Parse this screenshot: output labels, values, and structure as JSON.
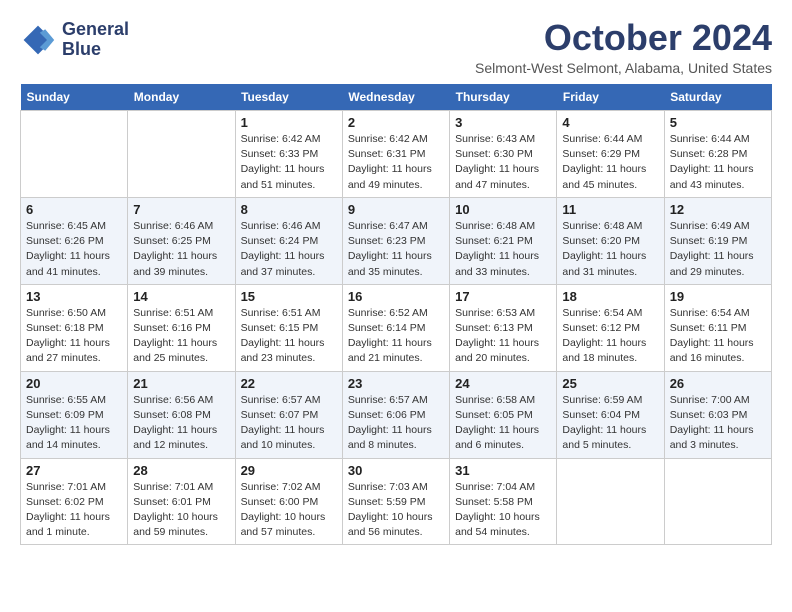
{
  "logo": {
    "line1": "General",
    "line2": "Blue"
  },
  "title": "October 2024",
  "subtitle": "Selmont-West Selmont, Alabama, United States",
  "headers": [
    "Sunday",
    "Monday",
    "Tuesday",
    "Wednesday",
    "Thursday",
    "Friday",
    "Saturday"
  ],
  "weeks": [
    [
      {
        "day": "",
        "info": ""
      },
      {
        "day": "",
        "info": ""
      },
      {
        "day": "1",
        "info": "Sunrise: 6:42 AM\nSunset: 6:33 PM\nDaylight: 11 hours and 51 minutes."
      },
      {
        "day": "2",
        "info": "Sunrise: 6:42 AM\nSunset: 6:31 PM\nDaylight: 11 hours and 49 minutes."
      },
      {
        "day": "3",
        "info": "Sunrise: 6:43 AM\nSunset: 6:30 PM\nDaylight: 11 hours and 47 minutes."
      },
      {
        "day": "4",
        "info": "Sunrise: 6:44 AM\nSunset: 6:29 PM\nDaylight: 11 hours and 45 minutes."
      },
      {
        "day": "5",
        "info": "Sunrise: 6:44 AM\nSunset: 6:28 PM\nDaylight: 11 hours and 43 minutes."
      }
    ],
    [
      {
        "day": "6",
        "info": "Sunrise: 6:45 AM\nSunset: 6:26 PM\nDaylight: 11 hours and 41 minutes."
      },
      {
        "day": "7",
        "info": "Sunrise: 6:46 AM\nSunset: 6:25 PM\nDaylight: 11 hours and 39 minutes."
      },
      {
        "day": "8",
        "info": "Sunrise: 6:46 AM\nSunset: 6:24 PM\nDaylight: 11 hours and 37 minutes."
      },
      {
        "day": "9",
        "info": "Sunrise: 6:47 AM\nSunset: 6:23 PM\nDaylight: 11 hours and 35 minutes."
      },
      {
        "day": "10",
        "info": "Sunrise: 6:48 AM\nSunset: 6:21 PM\nDaylight: 11 hours and 33 minutes."
      },
      {
        "day": "11",
        "info": "Sunrise: 6:48 AM\nSunset: 6:20 PM\nDaylight: 11 hours and 31 minutes."
      },
      {
        "day": "12",
        "info": "Sunrise: 6:49 AM\nSunset: 6:19 PM\nDaylight: 11 hours and 29 minutes."
      }
    ],
    [
      {
        "day": "13",
        "info": "Sunrise: 6:50 AM\nSunset: 6:18 PM\nDaylight: 11 hours and 27 minutes."
      },
      {
        "day": "14",
        "info": "Sunrise: 6:51 AM\nSunset: 6:16 PM\nDaylight: 11 hours and 25 minutes."
      },
      {
        "day": "15",
        "info": "Sunrise: 6:51 AM\nSunset: 6:15 PM\nDaylight: 11 hours and 23 minutes."
      },
      {
        "day": "16",
        "info": "Sunrise: 6:52 AM\nSunset: 6:14 PM\nDaylight: 11 hours and 21 minutes."
      },
      {
        "day": "17",
        "info": "Sunrise: 6:53 AM\nSunset: 6:13 PM\nDaylight: 11 hours and 20 minutes."
      },
      {
        "day": "18",
        "info": "Sunrise: 6:54 AM\nSunset: 6:12 PM\nDaylight: 11 hours and 18 minutes."
      },
      {
        "day": "19",
        "info": "Sunrise: 6:54 AM\nSunset: 6:11 PM\nDaylight: 11 hours and 16 minutes."
      }
    ],
    [
      {
        "day": "20",
        "info": "Sunrise: 6:55 AM\nSunset: 6:09 PM\nDaylight: 11 hours and 14 minutes."
      },
      {
        "day": "21",
        "info": "Sunrise: 6:56 AM\nSunset: 6:08 PM\nDaylight: 11 hours and 12 minutes."
      },
      {
        "day": "22",
        "info": "Sunrise: 6:57 AM\nSunset: 6:07 PM\nDaylight: 11 hours and 10 minutes."
      },
      {
        "day": "23",
        "info": "Sunrise: 6:57 AM\nSunset: 6:06 PM\nDaylight: 11 hours and 8 minutes."
      },
      {
        "day": "24",
        "info": "Sunrise: 6:58 AM\nSunset: 6:05 PM\nDaylight: 11 hours and 6 minutes."
      },
      {
        "day": "25",
        "info": "Sunrise: 6:59 AM\nSunset: 6:04 PM\nDaylight: 11 hours and 5 minutes."
      },
      {
        "day": "26",
        "info": "Sunrise: 7:00 AM\nSunset: 6:03 PM\nDaylight: 11 hours and 3 minutes."
      }
    ],
    [
      {
        "day": "27",
        "info": "Sunrise: 7:01 AM\nSunset: 6:02 PM\nDaylight: 11 hours and 1 minute."
      },
      {
        "day": "28",
        "info": "Sunrise: 7:01 AM\nSunset: 6:01 PM\nDaylight: 10 hours and 59 minutes."
      },
      {
        "day": "29",
        "info": "Sunrise: 7:02 AM\nSunset: 6:00 PM\nDaylight: 10 hours and 57 minutes."
      },
      {
        "day": "30",
        "info": "Sunrise: 7:03 AM\nSunset: 5:59 PM\nDaylight: 10 hours and 56 minutes."
      },
      {
        "day": "31",
        "info": "Sunrise: 7:04 AM\nSunset: 5:58 PM\nDaylight: 10 hours and 54 minutes."
      },
      {
        "day": "",
        "info": ""
      },
      {
        "day": "",
        "info": ""
      }
    ]
  ]
}
